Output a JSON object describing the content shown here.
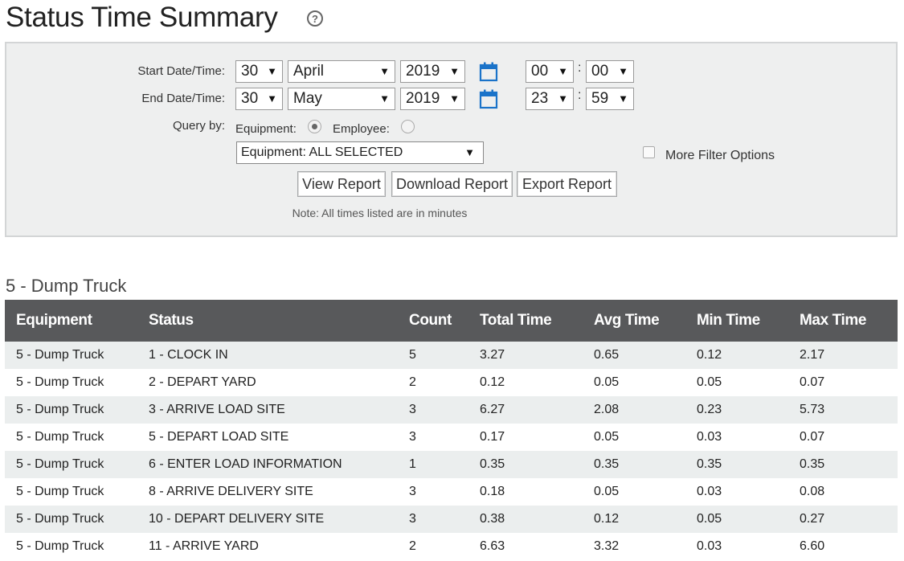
{
  "page": {
    "title": "Status Time Summary",
    "help_icon": "help-circle-icon"
  },
  "filters": {
    "start_label": "Start Date/Time:",
    "end_label": "End Date/Time:",
    "start": {
      "day": "30",
      "month": "April",
      "year": "2019",
      "hour": "00",
      "minute": "00"
    },
    "end": {
      "day": "30",
      "month": "May",
      "year": "2019",
      "hour": "23",
      "minute": "59"
    },
    "time_separator": ":",
    "calendar_icon": "calendar-icon",
    "query_by_label": "Query by:",
    "equipment_label": "Equipment:",
    "employee_label": "Employee:",
    "selected_query": "Equipment",
    "equipment_select_value": "Equipment: ALL SELECTED",
    "more_filter_label": "More Filter Options",
    "buttons": {
      "view": "View Report",
      "download": "Download Report",
      "export": "Export Report"
    },
    "note": "Note: All times listed are in minutes",
    "arrow_glyph": "▼"
  },
  "report": {
    "group_title": "5 - Dump Truck",
    "columns": [
      "Equipment",
      "Status",
      "Count",
      "Total Time",
      "Avg Time",
      "Min Time",
      "Max Time"
    ],
    "rows": [
      [
        "5 - Dump Truck",
        "1 - CLOCK IN",
        "5",
        "3.27",
        "0.65",
        "0.12",
        "2.17"
      ],
      [
        "5 - Dump Truck",
        "2 - DEPART YARD",
        "2",
        "0.12",
        "0.05",
        "0.05",
        "0.07"
      ],
      [
        "5 - Dump Truck",
        "3 - ARRIVE LOAD SITE",
        "3",
        "6.27",
        "2.08",
        "0.23",
        "5.73"
      ],
      [
        "5 - Dump Truck",
        "5 - DEPART LOAD SITE",
        "3",
        "0.17",
        "0.05",
        "0.03",
        "0.07"
      ],
      [
        "5 - Dump Truck",
        "6 - ENTER LOAD INFORMATION",
        "1",
        "0.35",
        "0.35",
        "0.35",
        "0.35"
      ],
      [
        "5 - Dump Truck",
        "8 - ARRIVE DELIVERY SITE",
        "3",
        "0.18",
        "0.05",
        "0.03",
        "0.08"
      ],
      [
        "5 - Dump Truck",
        "10 - DEPART DELIVERY SITE",
        "3",
        "0.38",
        "0.12",
        "0.05",
        "0.27"
      ],
      [
        "5 - Dump Truck",
        "11 - ARRIVE YARD",
        "2",
        "6.63",
        "3.32",
        "0.03",
        "6.60"
      ]
    ]
  },
  "colors": {
    "header_bg": "#58595b",
    "panel_bg": "#eeefef",
    "row_alt": "#ebeeee",
    "calendar_blue": "#1a73c9"
  }
}
